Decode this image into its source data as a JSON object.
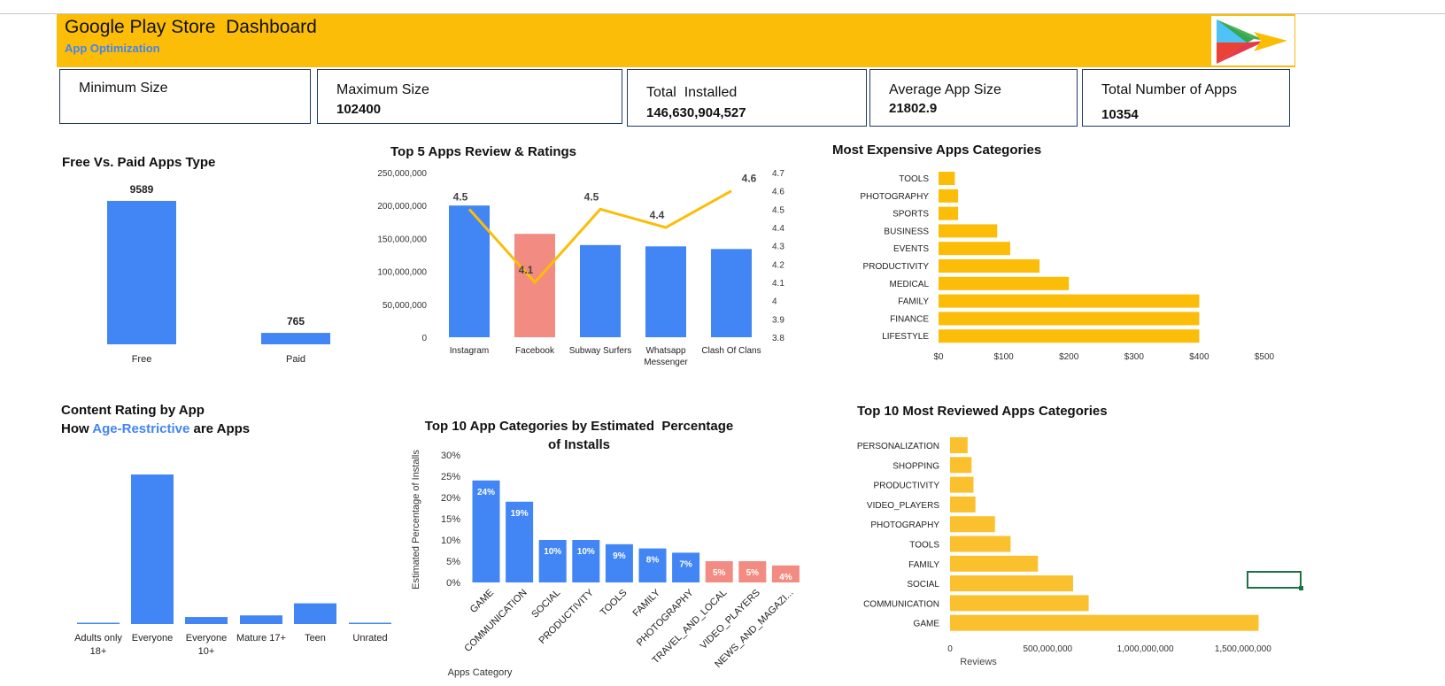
{
  "header": {
    "title": "Google Play Store  Dashboard",
    "subtitle": "App Optimization",
    "colors": {
      "banner": "#fbbd08",
      "subtitle": "#4285f4"
    },
    "logo_icon": "google-play-logo-icon"
  },
  "kpis": [
    {
      "label": "Minimum Size",
      "value": ""
    },
    {
      "label": "Maximum Size",
      "value": "102400"
    },
    {
      "label": "Total  Installed",
      "value": "146,630,904,527"
    },
    {
      "label": "Average App Size",
      "value": "21802.9"
    },
    {
      "label": "Total Number of Apps",
      "value": "10354"
    }
  ],
  "chart_data": [
    {
      "id": "free_paid",
      "type": "bar",
      "title": "Free Vs. Paid Apps Type",
      "categories": [
        "Free",
        "Paid"
      ],
      "values": [
        9589,
        765
      ],
      "data_labels": [
        "9589",
        "765"
      ],
      "color": "#4285f4",
      "ylim": [
        0,
        10000
      ],
      "grid": false
    },
    {
      "id": "top5_reviews_ratings",
      "type": "bar",
      "title": "Top 5 Apps Review & Ratings",
      "categories": [
        "Instagram",
        "Facebook",
        "Subway Surfers",
        "Whatsapp Messenger",
        "Clash Of Clans"
      ],
      "series": [
        {
          "type": "bar",
          "axis": "left",
          "values": [
            200000000,
            157000000,
            140000000,
            138000000,
            134000000
          ],
          "colors": [
            "#4285f4",
            "#f28b82",
            "#4285f4",
            "#4285f4",
            "#4285f4"
          ]
        },
        {
          "type": "line",
          "axis": "right",
          "values": [
            4.5,
            4.1,
            4.5,
            4.4,
            4.6
          ],
          "data_labels": [
            "4.5",
            "4.1",
            "4.5",
            "4.4",
            "4.6"
          ],
          "color": "#fbbd08"
        }
      ],
      "y_left": {
        "min": 0,
        "max": 250000000,
        "ticks": [
          "0",
          "50,000,000",
          "100,000,000",
          "150,000,000",
          "200,000,000",
          "250,000,000"
        ]
      },
      "y_right": {
        "min": 3.8,
        "max": 4.7,
        "ticks": [
          "3.8",
          "3.9",
          "4",
          "4.1",
          "4.2",
          "4.3",
          "4.4",
          "4.5",
          "4.6",
          "4.7"
        ]
      },
      "grid": false
    },
    {
      "id": "expensive_categories",
      "type": "bar",
      "orientation": "horizontal",
      "title": "Most Expensive Apps Categories",
      "categories": [
        "TOOLS",
        "PHOTOGRAPHY",
        "SPORTS",
        "BUSINESS",
        "EVENTS",
        "PRODUCTIVITY",
        "MEDICAL",
        "FAMILY",
        "FINANCE",
        "LIFESTYLE"
      ],
      "values": [
        25,
        30,
        30,
        90,
        110,
        155,
        200,
        400,
        400,
        400
      ],
      "xlim": [
        0,
        500
      ],
      "x_ticks": [
        "$0",
        "$100",
        "$200",
        "$300",
        "$400",
        "$500"
      ],
      "color": "#fbbd08",
      "grid": false
    },
    {
      "id": "content_rating",
      "type": "bar",
      "title": "Content Rating by App",
      "subtitle_parts": [
        "How ",
        "Age-Restrictive",
        " are Apps"
      ],
      "categories": [
        "Adults only 18+",
        "Everyone",
        "Everyone 10+",
        "Mature 17+",
        "Teen",
        "Unrated"
      ],
      "category_lines": [
        [
          "Adults only",
          "18+"
        ],
        [
          "Everyone"
        ],
        [
          "Everyone",
          "10+"
        ],
        [
          "Mature 17+"
        ],
        [
          "Teen"
        ],
        [
          "Unrated"
        ]
      ],
      "values": [
        3,
        8300,
        390,
        480,
        1150,
        2
      ],
      "ylim": [
        0,
        8500
      ],
      "color": "#4285f4",
      "grid": false
    },
    {
      "id": "install_share",
      "type": "bar",
      "title_lines": [
        "Top 10 App Categories by Estimated  Percentage",
        "of Installs"
      ],
      "categories": [
        "GAME",
        "COMMUNICATION",
        "SOCIAL",
        "PRODUCTIVITY",
        "TOOLS",
        "FAMILY",
        "PHOTOGRAPHY",
        "TRAVEL_AND_LOCAL",
        "VIDEO_PLAYERS",
        "NEWS_AND_MAGAZI..."
      ],
      "values": [
        24,
        19,
        10,
        10,
        9,
        8,
        7,
        5,
        5,
        4
      ],
      "data_labels": [
        "24%",
        "19%",
        "10%",
        "10%",
        "9%",
        "8%",
        "7%",
        "5%",
        "5%",
        "4%"
      ],
      "colors": [
        "#4285f4",
        "#4285f4",
        "#4285f4",
        "#4285f4",
        "#4285f4",
        "#4285f4",
        "#4285f4",
        "#f28b82",
        "#f28b82",
        "#f28b82"
      ],
      "ylim": [
        0,
        30
      ],
      "y_ticks": [
        "0%",
        "5%",
        "10%",
        "15%",
        "20%",
        "25%",
        "30%"
      ],
      "xlabel": "Apps Category",
      "ylabel": "Estimated Percentage of Installs",
      "grid": false
    },
    {
      "id": "most_reviewed",
      "type": "bar",
      "orientation": "horizontal",
      "title": "Top 10 Most Reviewed Apps Categories",
      "categories": [
        "PERSONALIZATION",
        "SHOPPING",
        "PRODUCTIVITY",
        "VIDEO_PLAYERS",
        "PHOTOGRAPHY",
        "TOOLS",
        "FAMILY",
        "SOCIAL",
        "COMMUNICATION",
        "GAME"
      ],
      "values": [
        90000000,
        110000000,
        120000000,
        130000000,
        230000000,
        310000000,
        450000000,
        630000000,
        710000000,
        1580000000
      ],
      "xlim": [
        0,
        1800000000
      ],
      "x_ticks": [
        "0",
        "500,000,000",
        "1,000,000,000",
        "1,500,000,000"
      ],
      "xlabel": "Reviews",
      "color": "#fbc02d",
      "grid": false
    }
  ]
}
